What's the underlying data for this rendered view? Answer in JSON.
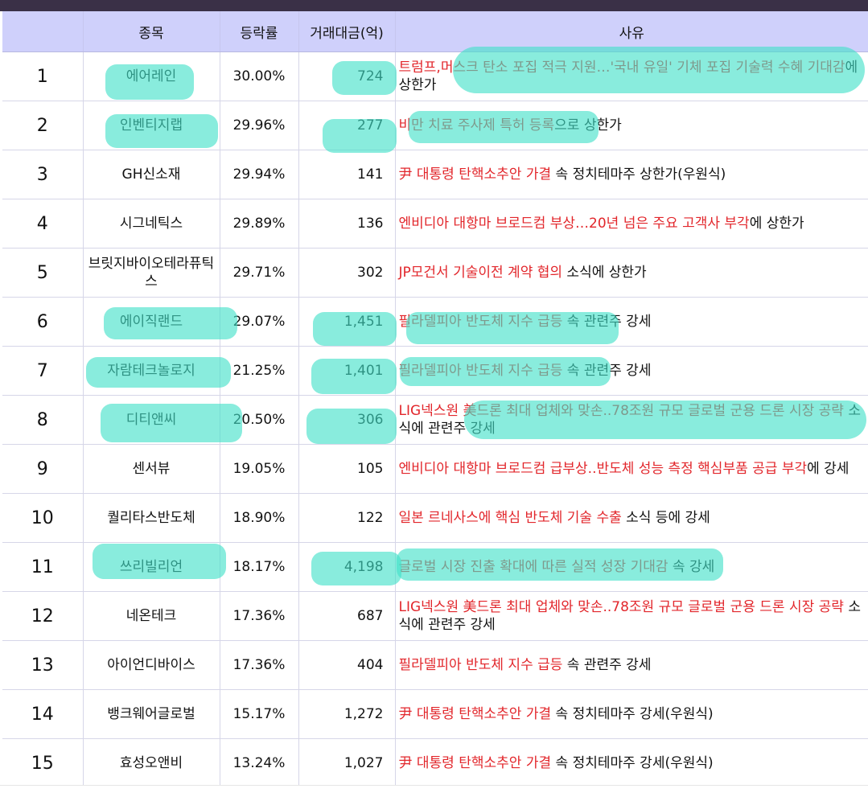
{
  "header": {
    "col_no": "",
    "col_name": "종목",
    "col_pct": "등락률",
    "col_amt": "거래대금(억)",
    "col_reason": "사유"
  },
  "rows": [
    {
      "no": "1",
      "name": "에어레인",
      "pct": "30.00%",
      "amt": "724",
      "reason_red": "트럼프,머스크 탄소 포집 적극 지원…'국내 유일' 기체 포집 기술력 수혜 기대감",
      "reason_black": "에 상한가"
    },
    {
      "no": "2",
      "name": "인벤티지랩",
      "pct": "29.96%",
      "amt": "277",
      "reason_red": "비만 치료 주사제 특허 등록",
      "reason_black": "으로 상한가"
    },
    {
      "no": "3",
      "name": "GH신소재",
      "pct": "29.94%",
      "amt": "141",
      "reason_red": "尹 대통령 탄핵소추안 가결",
      "reason_black": " 속 정치테마주 상한가(우원식)"
    },
    {
      "no": "4",
      "name": "시그네틱스",
      "pct": "29.89%",
      "amt": "136",
      "reason_red": "엔비디아 대항마 브로드컴 부상…20년 넘은 주요 고객사 부각",
      "reason_black": "에 상한가"
    },
    {
      "no": "5",
      "name": "브릿지바이오테라퓨틱스",
      "pct": "29.71%",
      "amt": "302",
      "reason_red": "JP모건서 기술이전 계약 협의",
      "reason_black": " 소식에 상한가"
    },
    {
      "no": "6",
      "name": "에이직랜드",
      "pct": "29.07%",
      "amt": "1,451",
      "reason_red": "필라델피아 반도체 지수 급등",
      "reason_black": " 속 관련주 강세"
    },
    {
      "no": "7",
      "name": "자람테크놀로지",
      "pct": "21.25%",
      "amt": "1,401",
      "reason_red": "필라델피아 반도체 지수 급등",
      "reason_black": " 속 관련주 강세"
    },
    {
      "no": "8",
      "name": "디티앤씨",
      "pct": "20.50%",
      "amt": "306",
      "reason_red": "LIG넥스원 美드론 최대 업체와 맞손..78조원 규모 글로벌 군용 드론 시장 공략",
      "reason_black": " 소식에 관련주 강세"
    },
    {
      "no": "9",
      "name": "센서뷰",
      "pct": "19.05%",
      "amt": "105",
      "reason_red": "엔비디아 대항마 브로드컴 급부상..반도체 성능 측정 핵심부품 공급 부각",
      "reason_black": "에 강세"
    },
    {
      "no": "10",
      "name": "퀄리타스반도체",
      "pct": "18.90%",
      "amt": "122",
      "reason_red": "일본 르네사스에 핵심 반도체 기술 수출",
      "reason_black": " 소식 등에 강세"
    },
    {
      "no": "11",
      "name": "쓰리빌리언",
      "pct": "18.17%",
      "amt": "4,198",
      "reason_red": "글로벌 시장 진출 확대에 따른 실적 성장 기대감",
      "reason_black": " 속 강세"
    },
    {
      "no": "12",
      "name": "네온테크",
      "pct": "17.36%",
      "amt": "687",
      "reason_red": "LIG넥스원 美드론 최대 업체와 맞손..78조원 규모 글로벌 군용 드론 시장 공략",
      "reason_black": " 소식에 관련주 강세"
    },
    {
      "no": "13",
      "name": "아이언디바이스",
      "pct": "17.36%",
      "amt": "404",
      "reason_red": "필라델피아 반도체 지수 급등",
      "reason_black": " 속 관련주 강세"
    },
    {
      "no": "14",
      "name": "뱅크웨어글로벌",
      "pct": "15.17%",
      "amt": "1,272",
      "reason_red": "尹 대통령 탄핵소추안 가결",
      "reason_black": " 속 정치테마주 강세(우원식)"
    },
    {
      "no": "15",
      "name": "효성오앤비",
      "pct": "13.24%",
      "amt": "1,027",
      "reason_red": "尹 대통령 탄핵소추안 가결",
      "reason_black": " 속 정치테마주 강세(우원식)"
    }
  ],
  "colors": {
    "header_bg": "#cfd0fb",
    "reason_red": "#e2262b",
    "highlighter": "#40e0c8"
  }
}
